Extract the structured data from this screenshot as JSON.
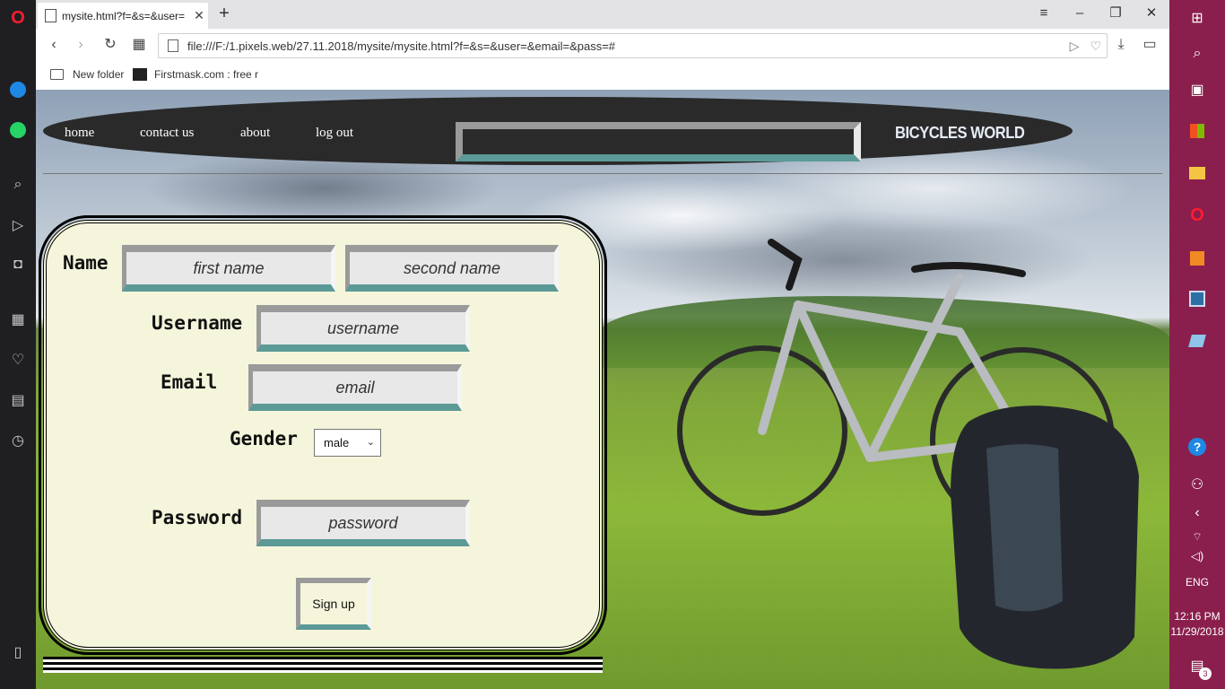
{
  "browser": {
    "tab_title": "mysite.html?f=&s=&user=",
    "url": "file:///F:/1.pixels.web/27.11.2018/mysite/mysite.html?f=&s=&user=&email=&pass=#",
    "bookmarks": [
      {
        "label": "New folder"
      },
      {
        "label": "Firstmask.com : free r"
      }
    ]
  },
  "nav": {
    "links": [
      "home",
      "contact us",
      "about",
      "log out"
    ],
    "brand": "BICYCLES WORLD"
  },
  "form": {
    "name_label": "Name",
    "first_name_placeholder": "first name",
    "second_name_placeholder": "second name",
    "username_label": "Username",
    "username_placeholder": "username",
    "email_label": "Email",
    "email_placeholder": "email",
    "gender_label": "Gender",
    "gender_value": "male",
    "password_label": "Password",
    "password_placeholder": "password",
    "signup_label": "Sign up"
  },
  "taskbar": {
    "language": "ENG",
    "time": "12:16 PM",
    "date": "11/29/2018",
    "notification_count": "3"
  },
  "colors": {
    "nav_background": "#2a2a2a",
    "form_background": "#f5f5dc",
    "input_accent": "#5b9a96",
    "taskbar": "#8a1f4d"
  }
}
